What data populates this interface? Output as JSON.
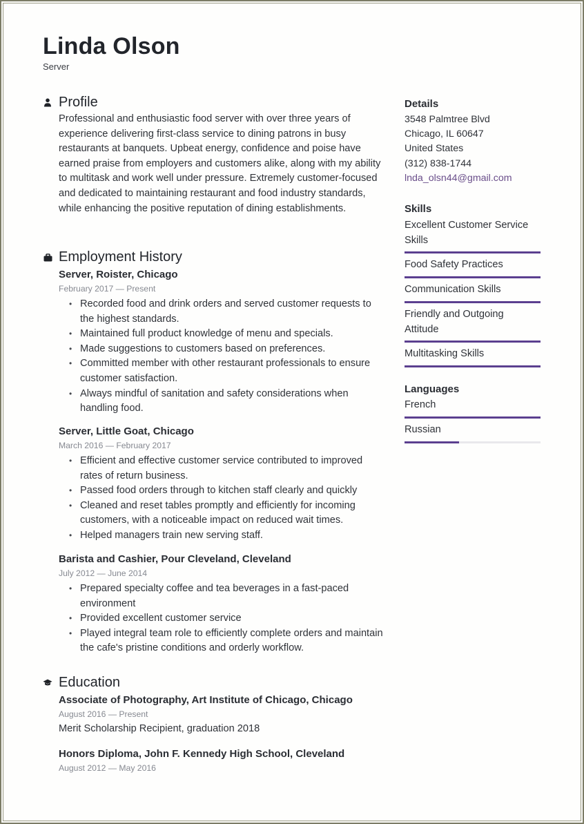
{
  "header": {
    "name": "Linda Olson",
    "title": "Server"
  },
  "profile": {
    "heading": "Profile",
    "icon": "person-icon",
    "text": "Professional and enthusiastic food server with over three years of experience delivering first-class service to dining patrons in busy restaurants at banquets. Upbeat energy, confidence and poise have earned praise from employers and customers alike, along with my ability to multitask and work well under pressure. Extremely customer-focused and dedicated to maintaining restaurant and food industry standards, while enhancing the positive reputation of dining establishments."
  },
  "employment": {
    "heading": "Employment History",
    "icon": "briefcase-icon",
    "jobs": [
      {
        "title": "Server, Roister, Chicago",
        "dates": "February 2017 — Present",
        "bullets": [
          "Recorded food and drink orders and served customer requests to the highest standards.",
          "Maintained full product knowledge of menu and specials.",
          "Made suggestions to customers based on preferences.",
          "Committed member with other restaurant professionals to ensure customer satisfaction.",
          "Always mindful of sanitation and safety considerations when handling food."
        ]
      },
      {
        "title": "Server, Little Goat, Chicago",
        "dates": "March 2016 — February 2017",
        "bullets": [
          "Efficient and effective customer service contributed to improved rates of return business.",
          "Passed food orders through to kitchen staff clearly and quickly",
          "Cleaned and reset tables promptly and efficiently for incoming customers, with a noticeable impact on reduced wait times.",
          "Helped managers train new serving staff."
        ]
      },
      {
        "title": "Barista and Cashier, Pour Cleveland, Cleveland",
        "dates": "July 2012 — June 2014",
        "bullets": [
          "Prepared specialty coffee and tea beverages in a fast-paced environment",
          "Provided excellent customer service",
          "Played integral team role to efficiently complete orders and maintain the cafe's pristine conditions and orderly workflow."
        ]
      }
    ]
  },
  "education": {
    "heading": "Education",
    "icon": "graduation-cap-icon",
    "entries": [
      {
        "title": "Associate of Photography, Art Institute of Chicago, Chicago",
        "dates": "August 2016 — Present",
        "note": "Merit Scholarship Recipient, graduation 2018"
      },
      {
        "title": "Honors Diploma, John F. Kennedy High School, Cleveland",
        "dates": "August 2012 — May 2016"
      }
    ]
  },
  "details": {
    "heading": "Details",
    "address1": "3548 Palmtree Blvd",
    "address2": "Chicago, IL 60647",
    "country": "United States",
    "phone": "(312) 838-1744",
    "email": "lnda_olsn44@gmail.com"
  },
  "skills": {
    "heading": "Skills",
    "items": [
      {
        "label": "Excellent Customer Service Skills",
        "level": 1.0
      },
      {
        "label": "Food Safety Practices",
        "level": 1.0
      },
      {
        "label": "Communication Skills",
        "level": 1.0
      },
      {
        "label": "Friendly and Outgoing Attitude",
        "level": 1.0
      },
      {
        "label": "Multitasking Skills",
        "level": 1.0
      }
    ]
  },
  "languages": {
    "heading": "Languages",
    "items": [
      {
        "label": "French",
        "level": 1.0
      },
      {
        "label": "Russian",
        "level": 0.4
      }
    ]
  },
  "colors": {
    "accent": "#5b3f8f",
    "link": "#6a4e8a",
    "frame": "#7c7c66"
  }
}
